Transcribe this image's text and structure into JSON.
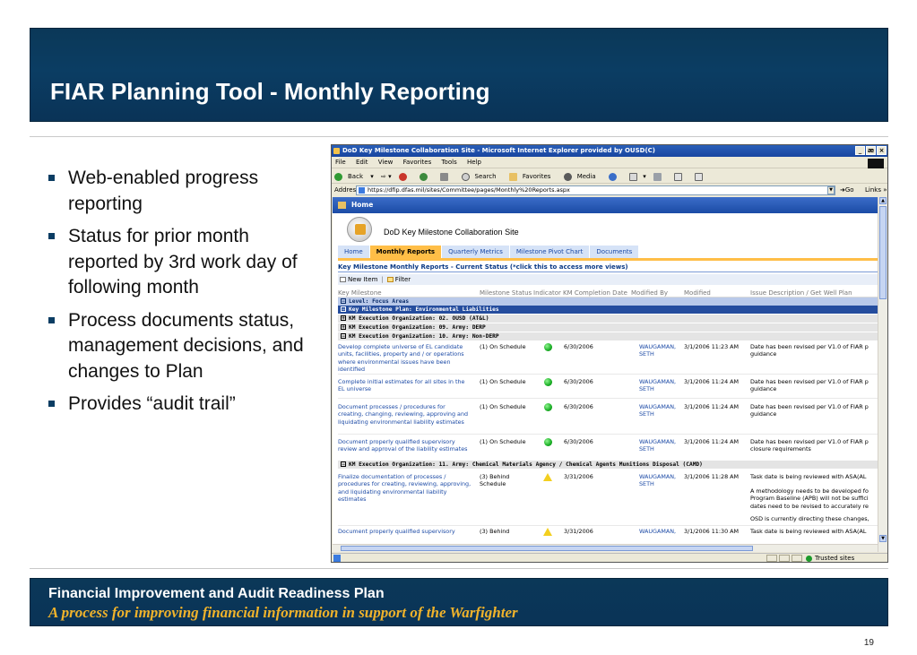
{
  "slide": {
    "title": "FIAR Planning Tool  -  Monthly Reporting",
    "bullets": [
      "Web-enabled progress reporting",
      "Status for prior month reported by 3rd work day of following month",
      "Process documents status, management decisions, and changes to Plan",
      "Provides “audit trail”"
    ],
    "footer_line1": "Financial Improvement and Audit Readiness Plan",
    "footer_line2": "A process for improving financial information in support of the Warfighter",
    "page_number": "19",
    "colors": {
      "title_bar": "#0b3d63",
      "footer_tagline": "#f0b32b",
      "bullet": "#0b3d63"
    }
  },
  "browser": {
    "window_title": "DoD Key Milestone Collaboration Site - Microsoft Internet Explorer provided by OUSD(C)",
    "window_buttons": [
      "_",
      "æ",
      "×"
    ],
    "menu": [
      "File",
      "Edit",
      "View",
      "Favorites",
      "Tools",
      "Help"
    ],
    "toolbar": {
      "back": "Back",
      "search": "Search",
      "favorites": "Favorites",
      "media": "Media"
    },
    "address_label": "Address",
    "address_url": "https://dfip.dfas.mil/sites/Committee/pages/Monthly%20Reports.aspx",
    "go_label": "Go",
    "links_label": "Links »",
    "status_zone": "Trusted sites"
  },
  "site": {
    "home_label": "Home",
    "name": "DoD Key Milestone Collaboration Site",
    "tabs": [
      {
        "label": "Home",
        "active": false
      },
      {
        "label": "Monthly Reports",
        "active": true
      },
      {
        "label": "Quarterly Metrics",
        "active": false
      },
      {
        "label": "Milestone Pivot Chart",
        "active": false
      },
      {
        "label": "Documents",
        "active": false
      }
    ],
    "list_title": "Key Milestone Monthly Reports - Current Status (*click this to access more views)",
    "new_item": "New Item",
    "filter": "Filter",
    "columns": [
      "Key Milestone",
      "Milestone Status",
      "Indicator",
      "KM Completion Date",
      "Modified By",
      "Modified",
      "Issue Description / Get Well Plan"
    ],
    "groups": {
      "level": "Level: Focus Areas",
      "plan": "Key Milestone Plan: Environmental Liabilities",
      "org02": "KM Execution Organization: 02. OUSD (AT&L)",
      "org09": "KM Execution Organization: 09. Army: DERP",
      "org10": "KM Execution Organization: 10. Army: Non-DERP",
      "org11": "KM Execution Organization: 11. Army: Chemical Materials Agency / Chemical Agents Munitions Disposal (CAMD)"
    },
    "rows": [
      {
        "milestone": "Develop complete universe of EL candidate units, facilities, property and / or operations where environmental issues have been identified",
        "status": "(1) On Schedule",
        "indicator": "green",
        "date": "6/30/2006",
        "by": "WAUGAMAN, SETH",
        "modified": "3/1/2006 11:23 AM",
        "issue": "Date has been revised per V1.0 of FIAR p guidance"
      },
      {
        "milestone": "Complete initial estimates for all sites in the EL universe",
        "status": "(1) On Schedule",
        "indicator": "green",
        "date": "6/30/2006",
        "by": "WAUGAMAN, SETH",
        "modified": "3/1/2006 11:24 AM",
        "issue": "Date has been revised per V1.0 of FIAR p guidance"
      },
      {
        "milestone": "Document processes / procedures for creating, changing, reviewing, approving and liquidating environmental liability estimates",
        "status": "(1) On Schedule",
        "indicator": "green",
        "date": "6/30/2006",
        "by": "WAUGAMAN, SETH",
        "modified": "3/1/2006 11:24 AM",
        "issue": "Date has been revised per V1.0 of FIAR p guidance"
      },
      {
        "milestone": "Document properly qualified supervisory review and approval of the liability estimates",
        "status": "(1) On Schedule",
        "indicator": "green",
        "date": "6/30/2006",
        "by": "WAUGAMAN, SETH",
        "modified": "3/1/2006 11:24 AM",
        "issue": "Date has been revised per V1.0 of FIAR p closure requirements"
      },
      {
        "milestone": "Finalize documentation of processes / procedures for creating, reviewing, approving, and liquidating environmental liability estimates",
        "status": "(3) Behind Schedule",
        "indicator": "yellow",
        "date": "3/31/2006",
        "by": "WAUGAMAN, SETH",
        "modified": "3/1/2006 11:28 AM",
        "issue": "Task date is being reviewed with ASA(AL",
        "issue_2": "A methodology needs to be developed fo Program Baseline (APB) will not be suffici dates need to be revised to accurately re",
        "issue_3": "OSD is currently directing these changes,"
      },
      {
        "milestone": "Document properly qualified supervisory",
        "status": "(3) Behind",
        "indicator": "yellow",
        "date": "3/31/2006",
        "by": "WAUGAMAN,",
        "modified": "3/1/2006 11:30 AM",
        "issue": "Task date is being reviewed with ASA(AL"
      }
    ]
  }
}
